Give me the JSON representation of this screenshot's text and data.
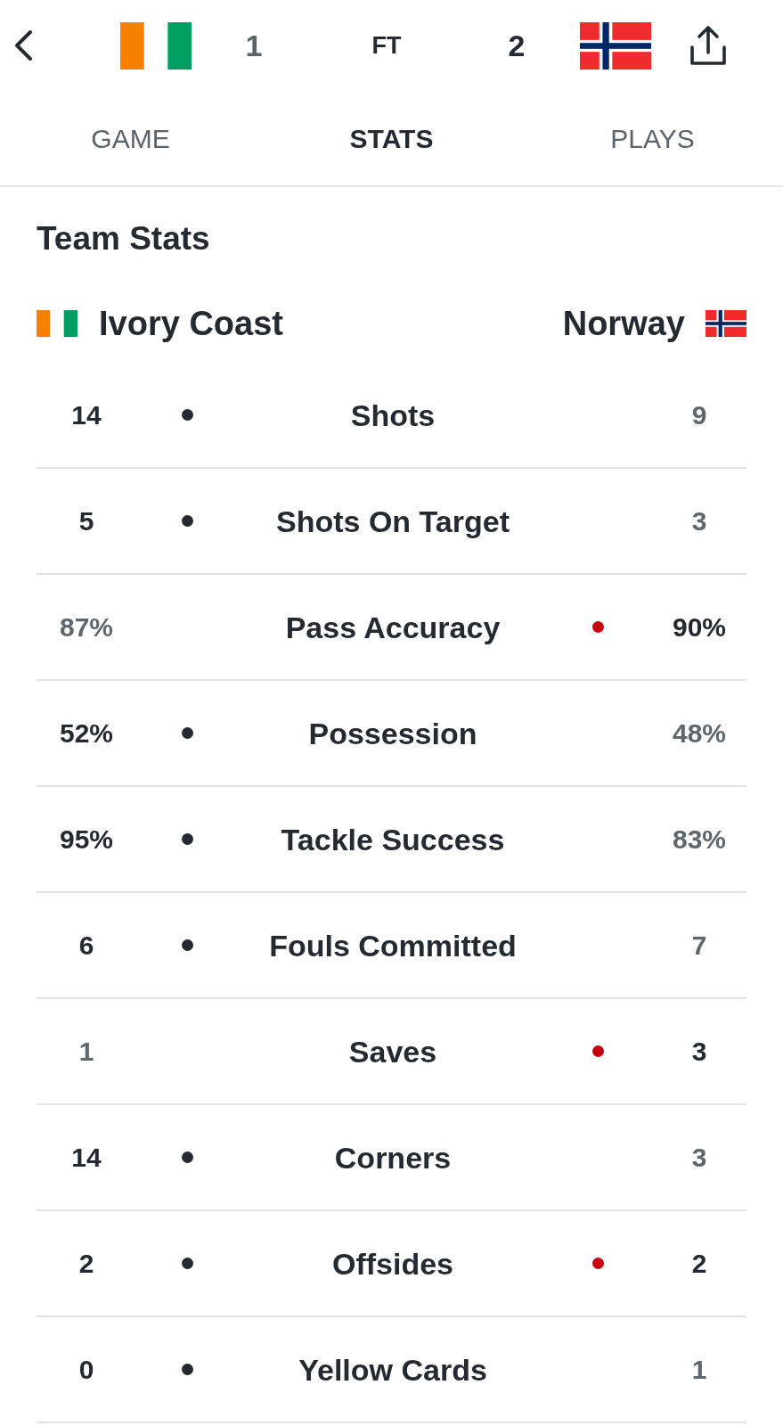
{
  "header": {
    "scores": [
      {
        "value": "1",
        "winner": false
      },
      {
        "value": "2",
        "winner": true
      }
    ],
    "status": "FT"
  },
  "tabs": [
    {
      "label": "GAME",
      "selected": false
    },
    {
      "label": "STATS",
      "selected": true
    },
    {
      "label": "PLAYS",
      "selected": false
    }
  ],
  "section_title": "Team Stats",
  "teams": [
    {
      "name": "Ivory Coast",
      "kind": "tricolor",
      "color": "#232a31"
    },
    {
      "name": "Norway",
      "kind": "cross",
      "color": "#c8000e"
    }
  ],
  "stats": [
    {
      "label": "Shots",
      "home": {
        "value": "14",
        "highlighted": true,
        "dot": true
      },
      "away": {
        "value": "9",
        "highlighted": false,
        "dot": false
      }
    },
    {
      "label": "Shots On Target",
      "home": {
        "value": "5",
        "highlighted": true,
        "dot": true
      },
      "away": {
        "value": "3",
        "highlighted": false,
        "dot": false
      }
    },
    {
      "label": "Pass Accuracy",
      "home": {
        "value": "87%",
        "highlighted": false,
        "dot": false
      },
      "away": {
        "value": "90%",
        "highlighted": true,
        "dot": true
      }
    },
    {
      "label": "Possession",
      "home": {
        "value": "52%",
        "highlighted": true,
        "dot": true
      },
      "away": {
        "value": "48%",
        "highlighted": false,
        "dot": false
      }
    },
    {
      "label": "Tackle Success",
      "home": {
        "value": "95%",
        "highlighted": true,
        "dot": true
      },
      "away": {
        "value": "83%",
        "highlighted": false,
        "dot": false
      }
    },
    {
      "label": "Fouls Committed",
      "home": {
        "value": "6",
        "highlighted": true,
        "dot": true
      },
      "away": {
        "value": "7",
        "highlighted": false,
        "dot": false
      }
    },
    {
      "label": "Saves",
      "home": {
        "value": "1",
        "highlighted": false,
        "dot": false
      },
      "away": {
        "value": "3",
        "highlighted": true,
        "dot": true
      }
    },
    {
      "label": "Corners",
      "home": {
        "value": "14",
        "highlighted": true,
        "dot": true
      },
      "away": {
        "value": "3",
        "highlighted": false,
        "dot": false
      }
    },
    {
      "label": "Offsides",
      "home": {
        "value": "2",
        "highlighted": true,
        "dot": true
      },
      "away": {
        "value": "2",
        "highlighted": true,
        "dot": true
      }
    },
    {
      "label": "Yellow Cards",
      "home": {
        "value": "0",
        "highlighted": true,
        "dot": true
      },
      "away": {
        "value": "1",
        "highlighted": false,
        "dot": false
      }
    }
  ]
}
